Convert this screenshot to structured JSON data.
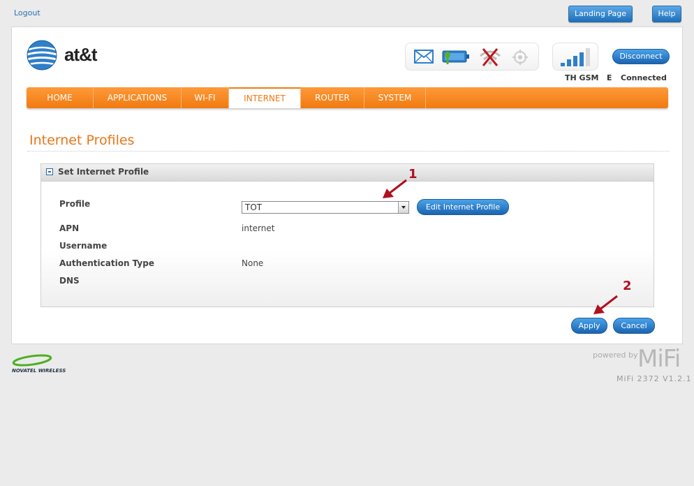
{
  "top": {
    "logout": "Logout",
    "landing_page": "Landing Page",
    "help": "Help"
  },
  "brand": {
    "logo_text": "at&t"
  },
  "status": {
    "disconnect": "Disconnect",
    "network": "TH GSM",
    "tech": "E",
    "connection": "Connected",
    "signal_bars": 5
  },
  "nav": {
    "items": [
      "HOME",
      "APPLICATIONS",
      "WI-FI",
      "INTERNET",
      "ROUTER",
      "SYSTEM"
    ],
    "active": "INTERNET"
  },
  "page": {
    "title": "Internet Profiles"
  },
  "section": {
    "title": "Set Internet Profile",
    "fields": {
      "profile_label": "Profile",
      "profile_value": "TOT",
      "edit_button": "Edit Internet Profile",
      "apn_label": "APN",
      "apn_value": "internet",
      "username_label": "Username",
      "username_value": "",
      "auth_label": "Authentication Type",
      "auth_value": "None",
      "dns_label": "DNS",
      "dns_value": ""
    }
  },
  "actions": {
    "apply": "Apply",
    "cancel": "Cancel"
  },
  "annotations": {
    "one": "1",
    "two": "2"
  },
  "footer": {
    "novatel": "NOVATEL WIRELESS",
    "powered_by": "powered by",
    "mifi": "MiFi",
    "version": "MiFi 2372 V1.2.1"
  },
  "colors": {
    "accent_orange": "#f07a10",
    "button_blue": "#1f6fb8",
    "annotation_red": "#b01020"
  }
}
